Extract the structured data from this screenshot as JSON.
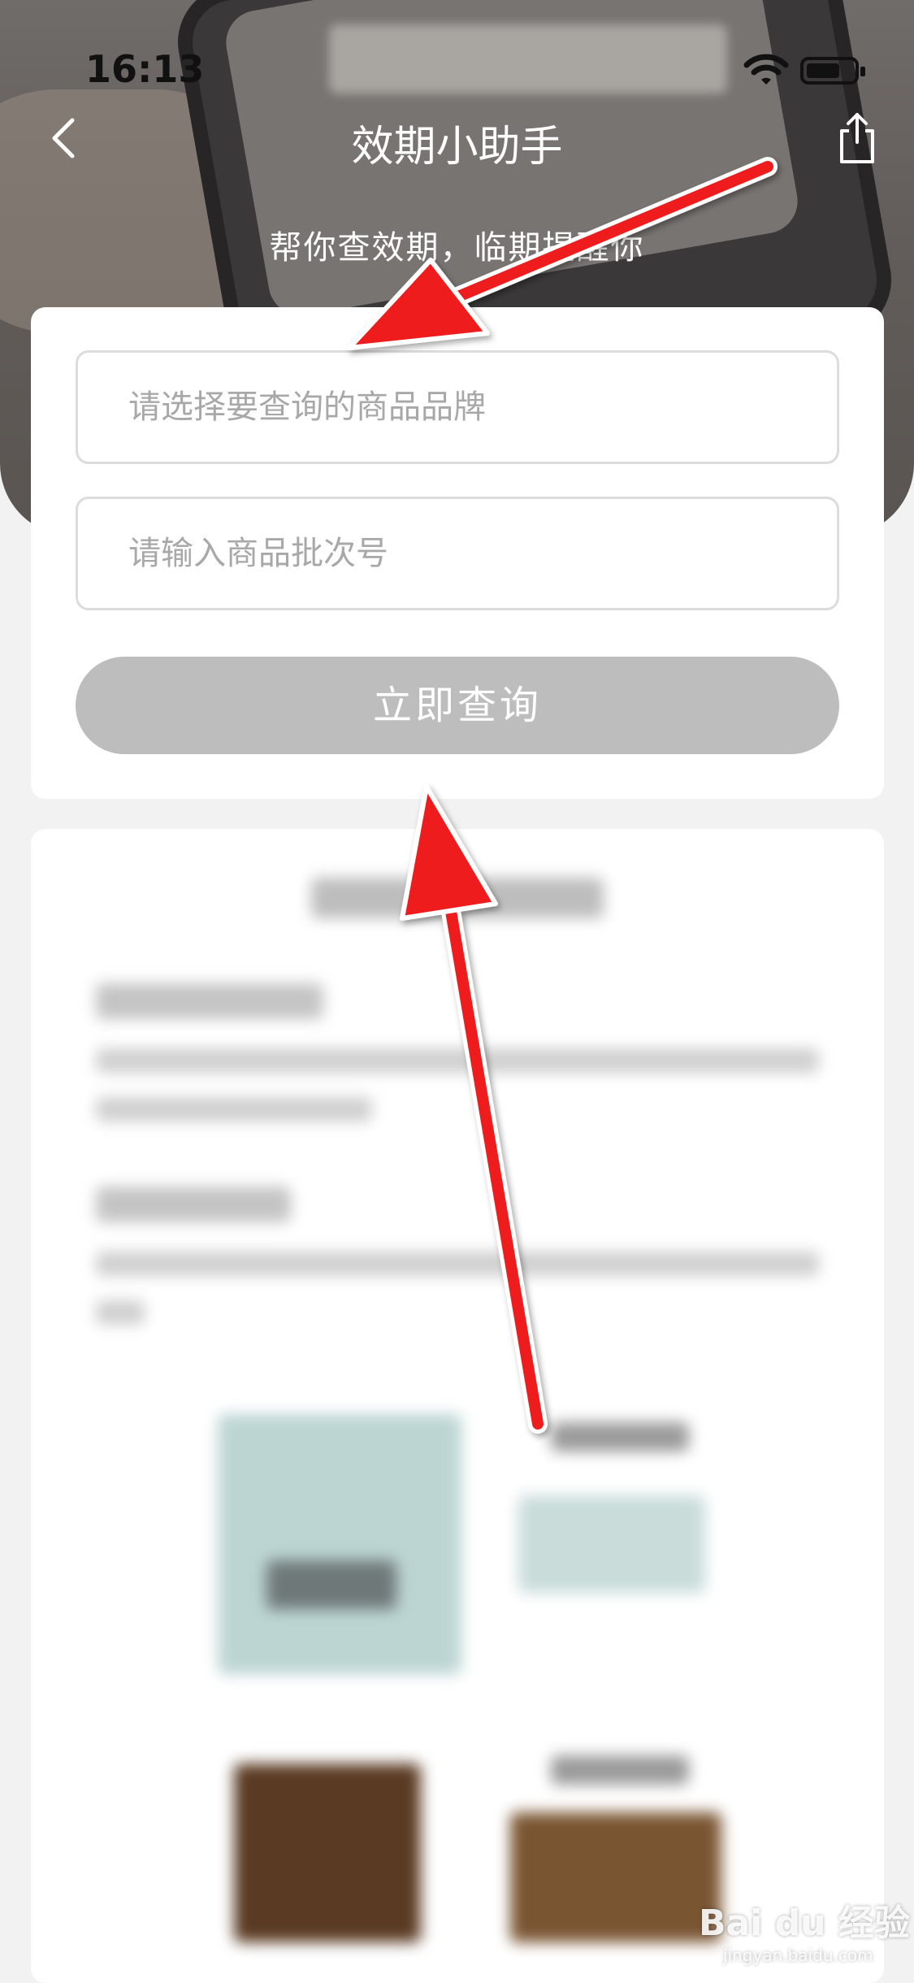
{
  "status_bar": {
    "time": "16:13"
  },
  "nav": {
    "title": "效期小助手"
  },
  "hero": {
    "subtitle": "帮你查效期，临期提醒你"
  },
  "form": {
    "brand_placeholder": "请选择要查询的商品品牌",
    "batch_placeholder": "请输入商品批次号",
    "submit_label": "立即查询"
  },
  "colors": {
    "button_disabled": "#bdbdbd",
    "annotation_arrow": "#ee1b1b"
  },
  "watermark": {
    "brand": "Bai du 经验",
    "url": "jingyan.baidu.com"
  }
}
